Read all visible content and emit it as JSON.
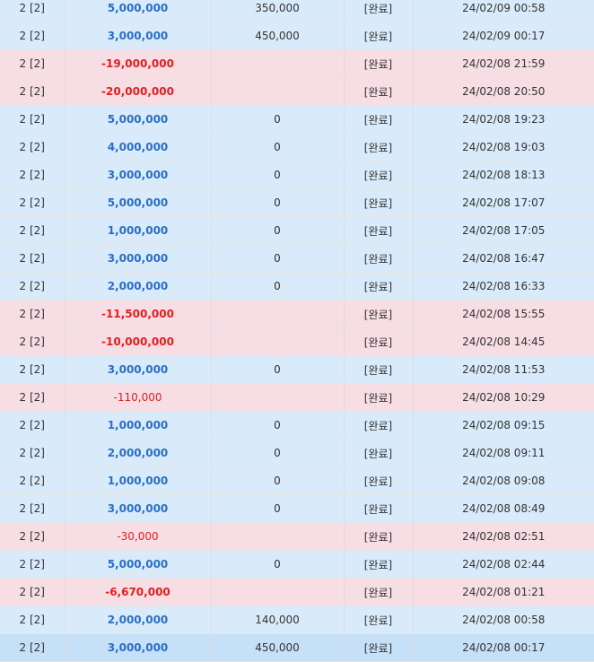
{
  "rows": [
    {
      "id": "2 [2]",
      "amount": "5,000,000",
      "bonus": "350,000",
      "status": "[완료]",
      "datetime": "24/02/09 00:58",
      "kind": "dep"
    },
    {
      "id": "2 [2]",
      "amount": "3,000,000",
      "bonus": "450,000",
      "status": "[완료]",
      "datetime": "24/02/09 00:17",
      "kind": "dep"
    },
    {
      "id": "2 [2]",
      "amount": "-19,000,000",
      "bonus": "",
      "status": "[완료]",
      "datetime": "24/02/08 21:59",
      "kind": "wd"
    },
    {
      "id": "2 [2]",
      "amount": "-20,000,000",
      "bonus": "",
      "status": "[완료]",
      "datetime": "24/02/08 20:50",
      "kind": "wd"
    },
    {
      "id": "2 [2]",
      "amount": "5,000,000",
      "bonus": "0",
      "status": "[완료]",
      "datetime": "24/02/08 19:23",
      "kind": "dep"
    },
    {
      "id": "2 [2]",
      "amount": "4,000,000",
      "bonus": "0",
      "status": "[완료]",
      "datetime": "24/02/08 19:03",
      "kind": "dep"
    },
    {
      "id": "2 [2]",
      "amount": "3,000,000",
      "bonus": "0",
      "status": "[완료]",
      "datetime": "24/02/08 18:13",
      "kind": "dep"
    },
    {
      "id": "2 [2]",
      "amount": "5,000,000",
      "bonus": "0",
      "status": "[완료]",
      "datetime": "24/02/08 17:07",
      "kind": "dep"
    },
    {
      "id": "2 [2]",
      "amount": "1,000,000",
      "bonus": "0",
      "status": "[완료]",
      "datetime": "24/02/08 17:05",
      "kind": "dep"
    },
    {
      "id": "2 [2]",
      "amount": "3,000,000",
      "bonus": "0",
      "status": "[완료]",
      "datetime": "24/02/08 16:47",
      "kind": "dep"
    },
    {
      "id": "2 [2]",
      "amount": "2,000,000",
      "bonus": "0",
      "status": "[완료]",
      "datetime": "24/02/08 16:33",
      "kind": "dep"
    },
    {
      "id": "2 [2]",
      "amount": "-11,500,000",
      "bonus": "",
      "status": "[완료]",
      "datetime": "24/02/08 15:55",
      "kind": "wd"
    },
    {
      "id": "2 [2]",
      "amount": "-10,000,000",
      "bonus": "",
      "status": "[완료]",
      "datetime": "24/02/08 14:45",
      "kind": "wd"
    },
    {
      "id": "2 [2]",
      "amount": "3,000,000",
      "bonus": "0",
      "status": "[완료]",
      "datetime": "24/02/08 11:53",
      "kind": "dep"
    },
    {
      "id": "2 [2]",
      "amount": "-110,000",
      "bonus": "",
      "status": "[완료]",
      "datetime": "24/02/08 10:29",
      "kind": "wd",
      "light": true
    },
    {
      "id": "2 [2]",
      "amount": "1,000,000",
      "bonus": "0",
      "status": "[완료]",
      "datetime": "24/02/08 09:15",
      "kind": "dep"
    },
    {
      "id": "2 [2]",
      "amount": "2,000,000",
      "bonus": "0",
      "status": "[완료]",
      "datetime": "24/02/08 09:11",
      "kind": "dep"
    },
    {
      "id": "2 [2]",
      "amount": "1,000,000",
      "bonus": "0",
      "status": "[완료]",
      "datetime": "24/02/08 09:08",
      "kind": "dep"
    },
    {
      "id": "2 [2]",
      "amount": "3,000,000",
      "bonus": "0",
      "status": "[완료]",
      "datetime": "24/02/08 08:49",
      "kind": "dep"
    },
    {
      "id": "2 [2]",
      "amount": "-30,000",
      "bonus": "",
      "status": "[완료]",
      "datetime": "24/02/08 02:51",
      "kind": "wd",
      "light": true
    },
    {
      "id": "2 [2]",
      "amount": "5,000,000",
      "bonus": "0",
      "status": "[완료]",
      "datetime": "24/02/08 02:44",
      "kind": "dep"
    },
    {
      "id": "2 [2]",
      "amount": "-6,670,000",
      "bonus": "",
      "status": "[완료]",
      "datetime": "24/02/08 01:21",
      "kind": "wd"
    },
    {
      "id": "2 [2]",
      "amount": "2,000,000",
      "bonus": "140,000",
      "status": "[완료]",
      "datetime": "24/02/08 00:58",
      "kind": "dep"
    },
    {
      "id": "2 [2]",
      "amount": "3,000,000",
      "bonus": "450,000",
      "status": "[완료]",
      "datetime": "24/02/08 00:17",
      "kind": "dep",
      "selected": true
    }
  ]
}
